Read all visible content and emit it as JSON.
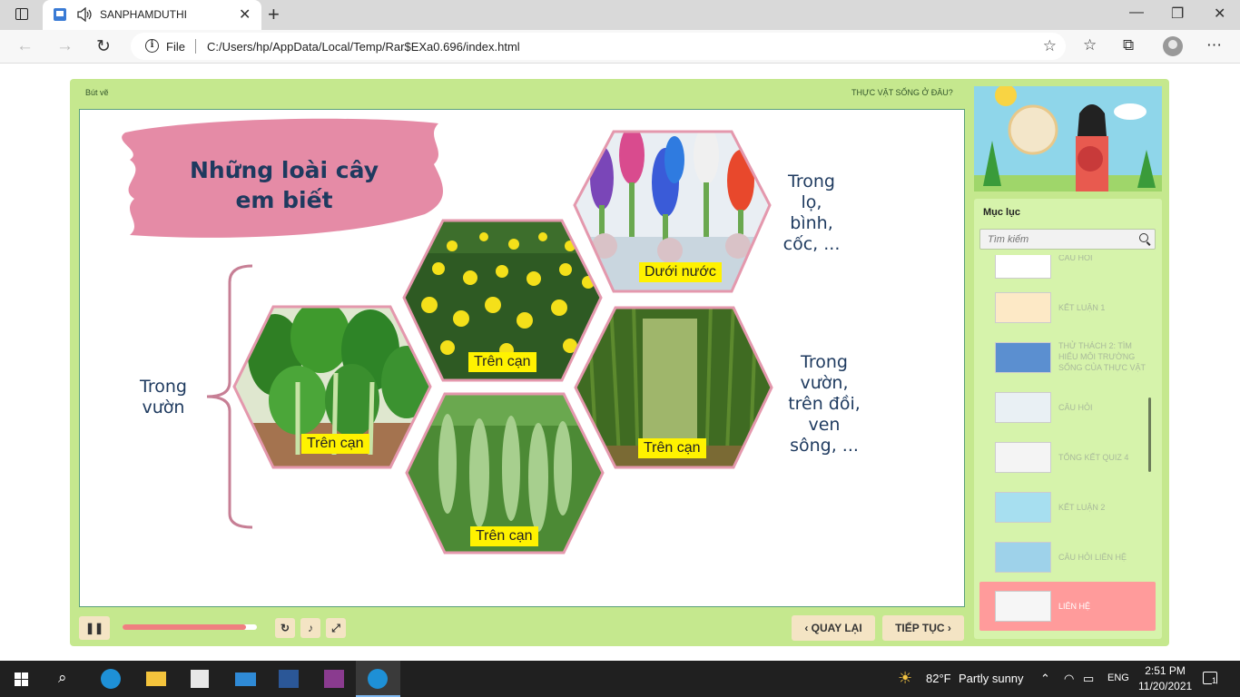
{
  "browser": {
    "tab_title": "SANPHAMDUTHI",
    "file_label": "File",
    "url": "C:/Users/hp/AppData/Local/Temp/Rar$EXa0.696/index.html"
  },
  "player": {
    "top_left": "Bút vẽ",
    "top_right": "THỰC VẬT SỐNG Ở ĐÂU?",
    "progress_percent": 92,
    "back_label": "QUAY LẠI",
    "next_label": "TIẾP TỤC"
  },
  "slide": {
    "title_line1": "Những loài cây",
    "title_line2": "em biết",
    "left_caption_1": "Trong",
    "left_caption_2": "vườn",
    "hex_labels": [
      "Dưới nước",
      "Trên cạn",
      "Trên cạn",
      "Trên cạn",
      "Trên cạn"
    ],
    "right_top": [
      "Trong",
      "lọ,",
      "bình,",
      "cốc, ..."
    ],
    "right_mid": [
      "Trong",
      "vườn,",
      "trên đồi,",
      "ven",
      "sông, ..."
    ]
  },
  "menu": {
    "title": "Mục lục",
    "search_placeholder": "Tìm kiếm",
    "items": [
      {
        "label": "CÂU HỎI"
      },
      {
        "label": "KẾT LUẬN 1"
      },
      {
        "label": "THỬ THÁCH 2: TÌM HIỂU MÔI TRƯỜNG SỐNG CỦA THỰC VẬT"
      },
      {
        "label": "CÂU HỎI"
      },
      {
        "label": "TỔNG KẾT QUIZ 4"
      },
      {
        "label": "KẾT LUẬN 2"
      },
      {
        "label": "CÂU HỎI LIÊN HỆ"
      },
      {
        "label": "LIÊN HỆ"
      }
    ]
  },
  "taskbar": {
    "weather": "82°F",
    "weather_desc": "Partly sunny",
    "lang": "ENG",
    "time": "2:51 PM",
    "date": "11/20/2021",
    "notif": "1"
  }
}
